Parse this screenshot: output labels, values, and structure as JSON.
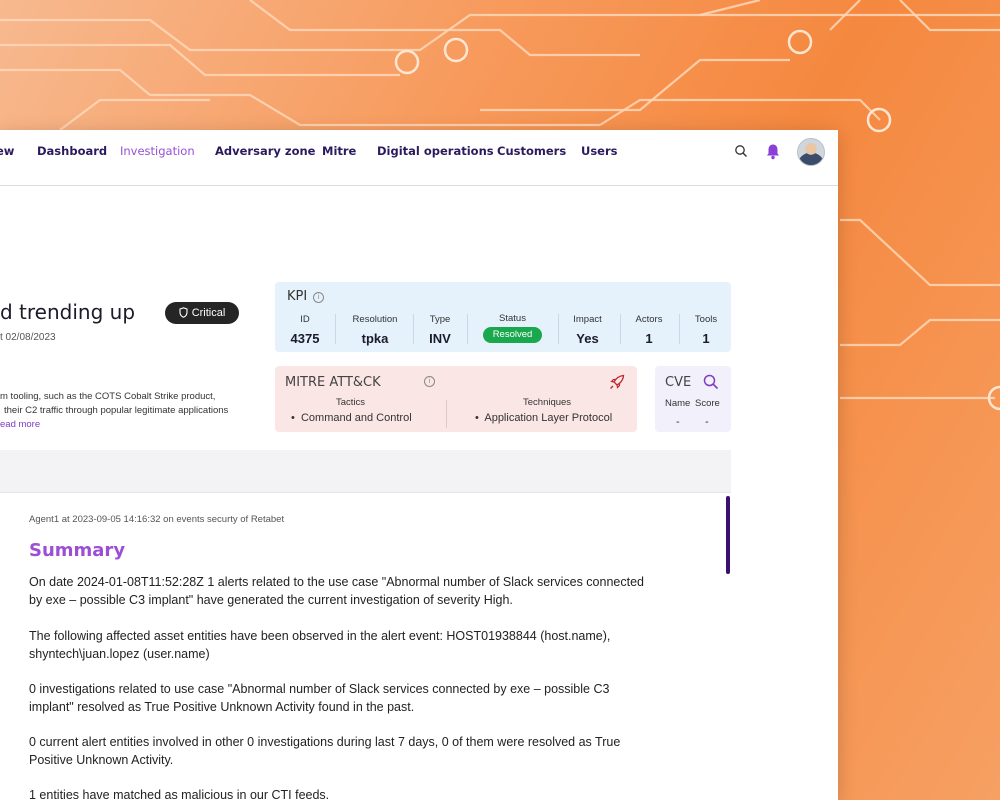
{
  "colors": {
    "accent": "#9a4fd6",
    "nav_text": "#2b1a5e",
    "critical": "#252525",
    "resolved": "#1aa84f",
    "kpi_bg": "#e5f2fb",
    "mitre_bg": "#fbe6e6",
    "cve_bg": "#f1f0fb",
    "background": "#f79a5c"
  },
  "nav": {
    "items": [
      "ew",
      "Dashboard",
      "Investigation",
      "Adversary zone",
      "Mitre",
      "Digital operations",
      "Customers",
      "Users"
    ],
    "active": "Investigation",
    "icons": [
      "search-icon",
      "bell-icon",
      "avatar"
    ]
  },
  "header": {
    "title": "d trending up",
    "date": "t 02/08/2023",
    "severity": "Critical",
    "severity_icon": "shield-icon"
  },
  "description": {
    "line1": "m tooling, such as the COTS Cobalt Strike product,",
    "line2": "their C2 traffic through popular legitimate applications",
    "read_more": "ead more"
  },
  "kpi": {
    "title": "KPI",
    "id_label": "ID",
    "id": "4375",
    "resolution_label": "Resolution",
    "resolution": "tpka",
    "type_label": "Type",
    "type": "INV",
    "status_label": "Status",
    "status": "Resolved",
    "impact_label": "Impact",
    "impact": "Yes",
    "actors_label": "Actors",
    "actors": "1",
    "tools_label": "Tools",
    "tools": "1"
  },
  "mitre": {
    "title": "MITRE ATT&CK",
    "tactics_label": "Tactics",
    "tactic": "Command and Control",
    "techniques_label": "Techniques",
    "technique": "Application Layer Protocol"
  },
  "cve": {
    "title": "CVE",
    "name_label": "Name",
    "score_label": "Score",
    "name": "-",
    "score": "-"
  },
  "summary": {
    "meta": "Agent1 at 2023-09-05 14:16:32 on events securty of Retabet",
    "title": "Summary",
    "p1a": "On date 2024-01-08T11:52:28Z 1 alerts related to the use case \"Abnormal number of Slack services connected",
    "p1b": "by exe – possible C3 implant\" have generated the current investigation of severity High.",
    "p2a": "The following affected asset entities have been observed in the alert event: HOST01938844 (host.name),",
    "p2b": "shyntech\\juan.lopez (user.name)",
    "p3a": "0 investigations related to use case \"Abnormal number of Slack services connected by exe – possible C3",
    "p3b": "implant\" resolved as True Positive Unknown Activity found in the past.",
    "p4a": "0 current alert entities involved in other 0 investigations during last 7 days, 0 of them were resolved as True",
    "p4b": "Positive Unknown Activity.",
    "p5": "1 entities have matched as malicious in our CTI feeds."
  }
}
